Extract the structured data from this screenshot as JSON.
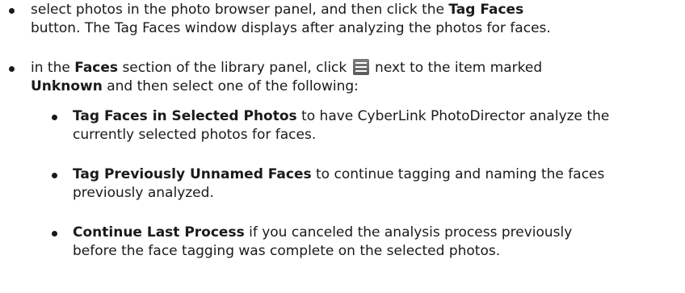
{
  "items": [
    {
      "line1_pre": "select photos in the photo browser panel, and then click the ",
      "line1_bold": "Tag Faces",
      "line2": "button. The Tag Faces window displays after analyzing the photos for faces."
    },
    {
      "line1_pre": "in the ",
      "line1_bold": "Faces",
      "line1_mid": " section of the library panel, click ",
      "line1_post": " next to the item marked",
      "line2_bold": "Unknown",
      "line2_post": " and then select one of the following:",
      "icon": "menu-lines-icon"
    }
  ],
  "subitems": [
    {
      "bold": "Tag Faces in Selected Photos",
      "line1": " to have CyberLink PhotoDirector analyze the",
      "line2": "currently selected photos for faces."
    },
    {
      "bold": "Tag Previously Unnamed Faces",
      "line1": " to continue tagging and naming the faces",
      "line2": "previously analyzed."
    },
    {
      "bold": "Continue Last Process",
      "line1": " if you canceled the analysis process previously",
      "line2": "before the face tagging was complete on the selected photos."
    }
  ]
}
